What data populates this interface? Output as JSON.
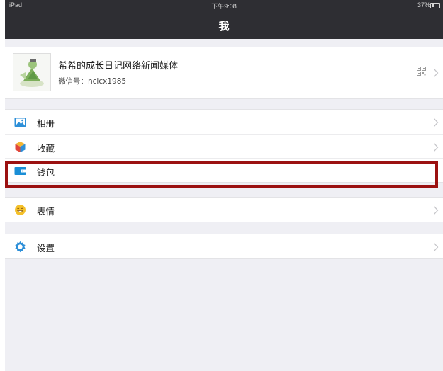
{
  "status_bar": {
    "device": "iPad",
    "time": "下午9:08",
    "battery": "37%"
  },
  "nav": {
    "title": "我"
  },
  "profile": {
    "name": "希希的成长日记网络新闻媒体",
    "wechat_id": "微信号：nclcx1985"
  },
  "menu": {
    "album": "相册",
    "favorites": "收藏",
    "wallet": "钱包",
    "emoji": "表情",
    "settings": "设置"
  },
  "colors": {
    "nav_bg": "#2e2e33",
    "page_bg": "#efeff4",
    "highlight_border": "#9b1111",
    "album_icon": "#2d8fd8",
    "wallet_icon": "#1a8ed6",
    "emoji_icon": "#f4c02a",
    "settings_icon": "#2d8fd8"
  },
  "icons": {
    "qr": "qr-code-icon",
    "chevron": "chevron-right-icon"
  }
}
